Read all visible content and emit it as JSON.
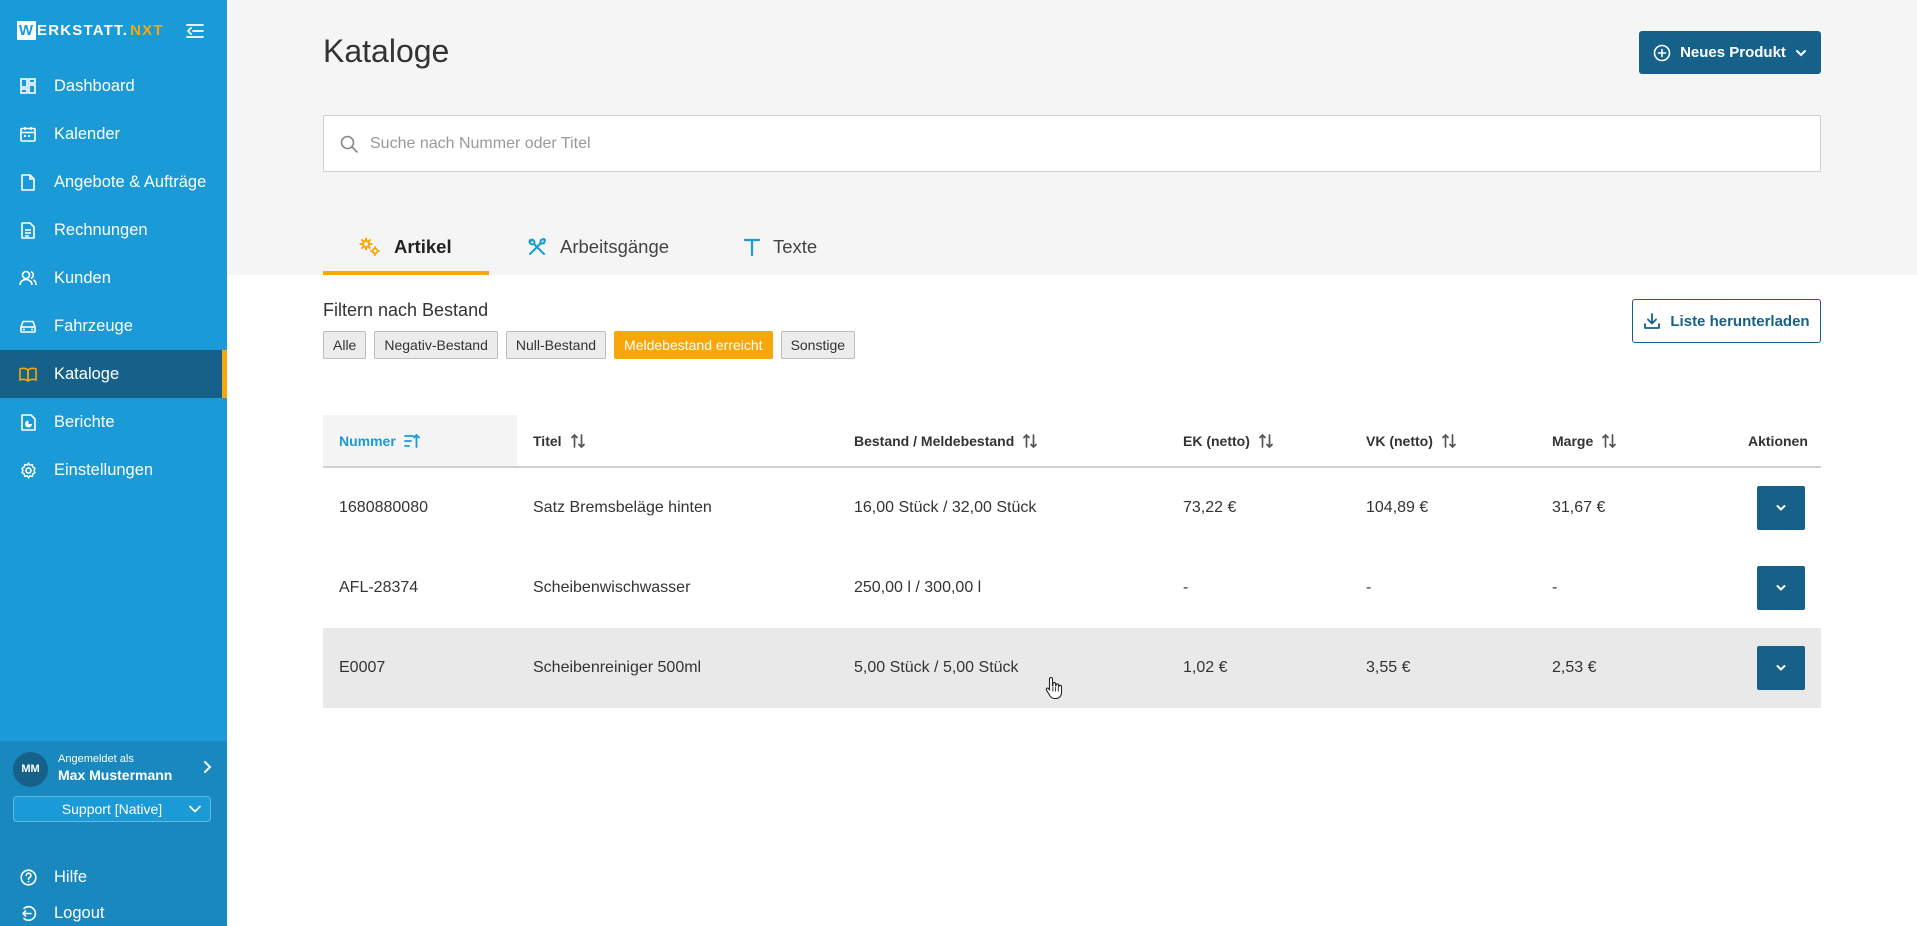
{
  "app": {
    "logo_w": "W",
    "logo_main": "ERKSTATT.",
    "logo_accent": "NXT"
  },
  "sidebar": {
    "items": [
      {
        "label": "Dashboard",
        "icon": "dashboard-icon"
      },
      {
        "label": "Kalender",
        "icon": "calendar-icon"
      },
      {
        "label": "Angebote & Aufträge",
        "icon": "document-icon"
      },
      {
        "label": "Rechnungen",
        "icon": "invoice-icon"
      },
      {
        "label": "Kunden",
        "icon": "users-icon"
      },
      {
        "label": "Fahrzeuge",
        "icon": "car-icon"
      },
      {
        "label": "Kataloge",
        "icon": "book-icon",
        "active": true
      },
      {
        "label": "Berichte",
        "icon": "report-icon"
      },
      {
        "label": "Einstellungen",
        "icon": "gear-icon"
      }
    ],
    "user": {
      "initials": "MM",
      "logged_in_label": "Angemeldet als",
      "name": "Max Mustermann"
    },
    "support_select": "Support [Native]",
    "help_label": "Hilfe",
    "logout_label": "Logout"
  },
  "header": {
    "title": "Kataloge",
    "new_button_label": "Neues Produkt"
  },
  "search": {
    "placeholder": "Suche nach Nummer oder Titel",
    "value": ""
  },
  "tabs": [
    {
      "label": "Artikel",
      "active": true
    },
    {
      "label": "Arbeitsgänge",
      "active": false
    },
    {
      "label": "Texte",
      "active": false
    }
  ],
  "filter": {
    "label": "Filtern nach Bestand",
    "chips": [
      {
        "label": "Alle",
        "active": false
      },
      {
        "label": "Negativ-Bestand",
        "active": false
      },
      {
        "label": "Null-Bestand",
        "active": false
      },
      {
        "label": "Meldebestand erreicht",
        "active": true
      },
      {
        "label": "Sonstige",
        "active": false
      }
    ],
    "download_label": "Liste herunterladen"
  },
  "table": {
    "columns": [
      "Nummer",
      "Titel",
      "Bestand / Meldebestand",
      "EK (netto)",
      "VK (netto)",
      "Marge",
      "Aktionen"
    ],
    "rows": [
      {
        "nummer": "1680880080",
        "titel": "Satz Bremsbeläge hinten",
        "bestand": "16,00 Stück / 32,00 Stück",
        "ek": "73,22 €",
        "vk": "104,89 €",
        "marge": "31,67 €"
      },
      {
        "nummer": "AFL-28374",
        "titel": "Scheibenwischwasser",
        "bestand": "250,00 l / 300,00 l",
        "ek": "-",
        "vk": "-",
        "marge": "-"
      },
      {
        "nummer": "E0007",
        "titel": "Scheibenreiniger 500ml",
        "bestand": "5,00 Stück / 5,00 Stück",
        "ek": "1,02 €",
        "vk": "3,55 €",
        "marge": "2,53 €"
      }
    ]
  },
  "colors": {
    "sidebar": "#1a9ad6",
    "primary": "#16618a",
    "accent": "#f7a70a"
  }
}
